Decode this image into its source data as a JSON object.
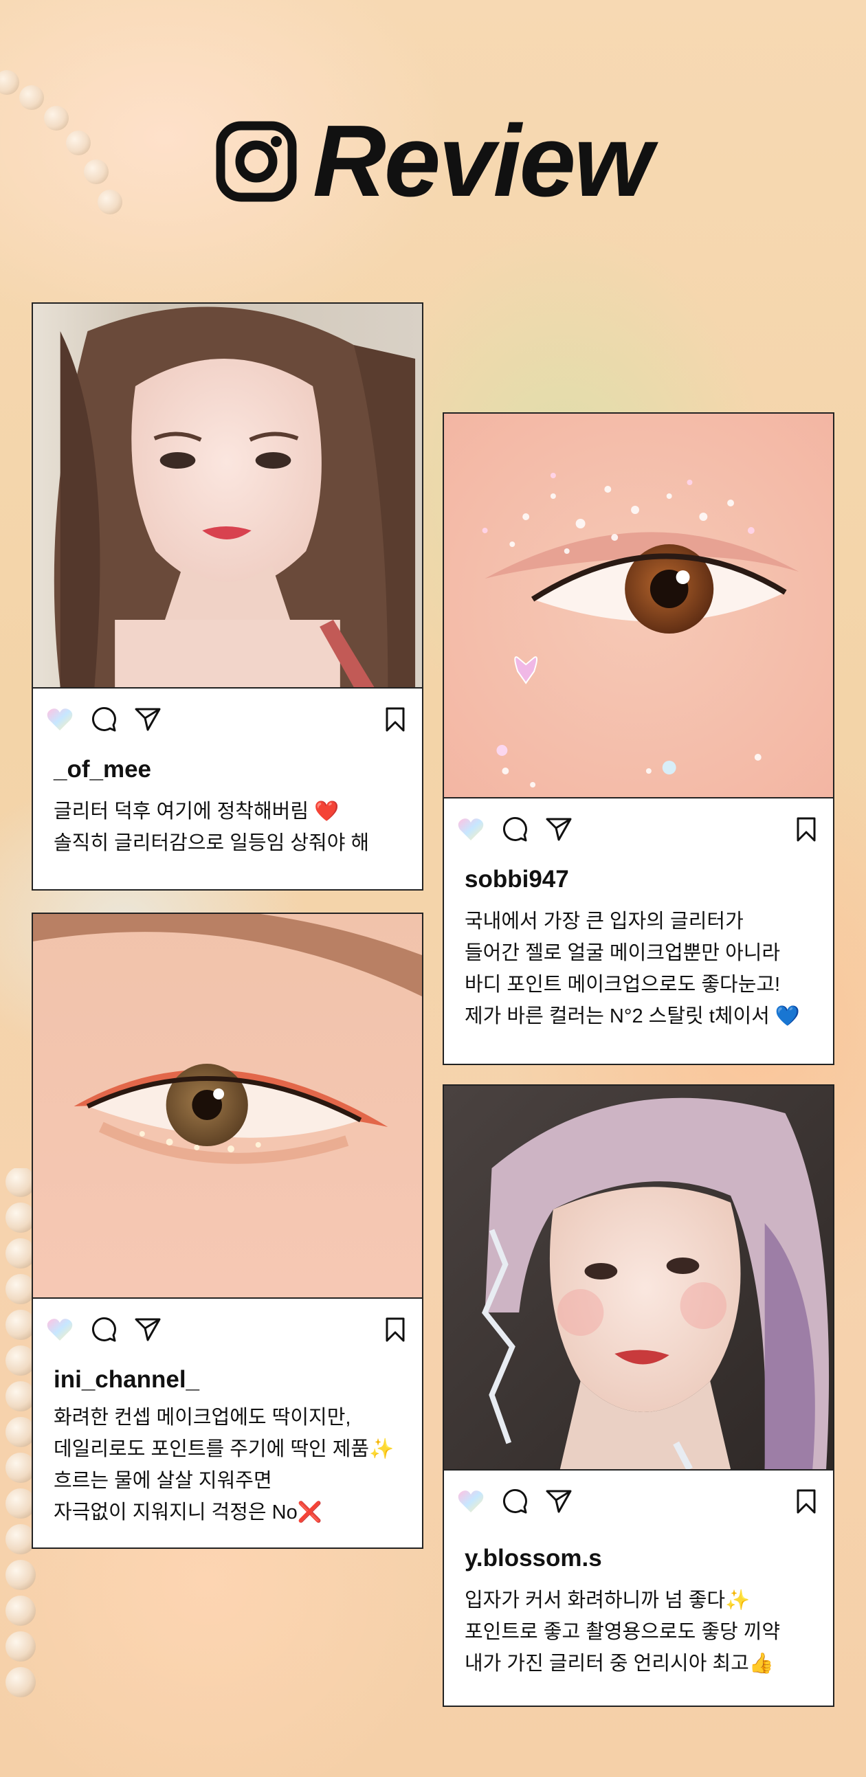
{
  "header": {
    "title": "Review",
    "logo_icon": "instagram-icon"
  },
  "posts": [
    {
      "username": "_of_mee",
      "caption": [
        "글리터 덕후 여기에 정착해버림 ❤️",
        "솔직히 글리터감으로 일등임 상줘야 해"
      ],
      "image": "woman-portrait-photo"
    },
    {
      "username": "sobbi947",
      "caption": [
        "국내에서 가장 큰 입자의 글리터가",
        "들어간 젤로 얼굴 메이크업뿐만 아니라",
        "바디 포인트 메이크업으로도 좋다눈고!",
        "제가 바른 컬러는 N°2 스탈릿 t체이서 💙"
      ],
      "image": "glitter-eye-closeup-photo"
    },
    {
      "username": "ini_channel_",
      "caption": [
        "화려한 컨셉 메이크업에도 딱이지만,",
        "데일리로도 포인트를 주기에 딱인 제품✨",
        "흐르는 물에 살살 지워주면",
        "자극없이 지워지니 걱정은 No❌"
      ],
      "image": "orange-eye-makeup-photo"
    },
    {
      "username": "y.blossom.s",
      "caption": [
        "입자가 커서 화려하니까 넘 좋다✨",
        "포인트로 좋고 촬영용으로도 좋당 끼약",
        "내가 가진 글리터 중 언리시아 최고👍"
      ],
      "image": "purple-hair-portrait-photo"
    }
  ],
  "icons": [
    "heart-icon",
    "comment-icon",
    "share-icon",
    "bookmark-icon"
  ],
  "colors": {
    "border": "#222222",
    "card": "#ffffff",
    "text": "#111111",
    "background": "#f5d5ab"
  }
}
